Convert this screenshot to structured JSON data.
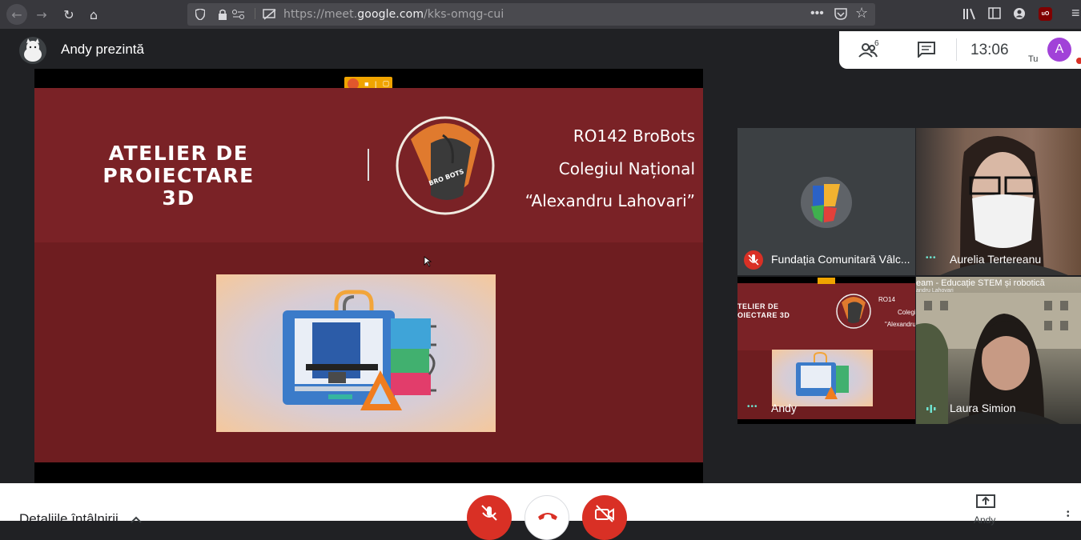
{
  "browser": {
    "url_prefix": "https://meet.",
    "url_domain": "google.com",
    "url_path": "/kks-omqg-cui"
  },
  "meet": {
    "presenter_title": "Andy prezintă",
    "clock": "13:06",
    "participants_count": "6",
    "self_label": "Tu",
    "user_initial": "A",
    "meeting_details": "Detaliile întâlnirii",
    "present_label": "Andy"
  },
  "slide": {
    "title_line1": "ATELIER DE",
    "title_line2": "PROIECTARE 3D",
    "team": "RO142 BroBots",
    "school_line1": "Colegiul Național",
    "school_line2": "“Alexandru Lahovari”",
    "logo_text": "BRO BOTS"
  },
  "participants": [
    {
      "name": "Fundația Comunitară Vâlc...",
      "muted": true
    },
    {
      "name": "Aurelia Tertereanu",
      "muted": false
    },
    {
      "name": "Andy",
      "muted": false
    },
    {
      "name": "Laura Simion",
      "muted": false
    }
  ],
  "mini_slide": {
    "banner": "eam - Educație STEM și robotică",
    "banner_sub": "andru Lahovari",
    "title_line1": "TELIER DE",
    "title_line2": "OIECTARE 3D",
    "team_short": "RO14",
    "school_short": "Colegi",
    "school_short2": "\"Alexandru"
  },
  "colors": {
    "slide_top": "#7a2226",
    "slide_bottom": "#6e1d20",
    "end_call": "#d93025",
    "avatar": "#a142d8",
    "speaking_dots": "#6fe3d0"
  }
}
